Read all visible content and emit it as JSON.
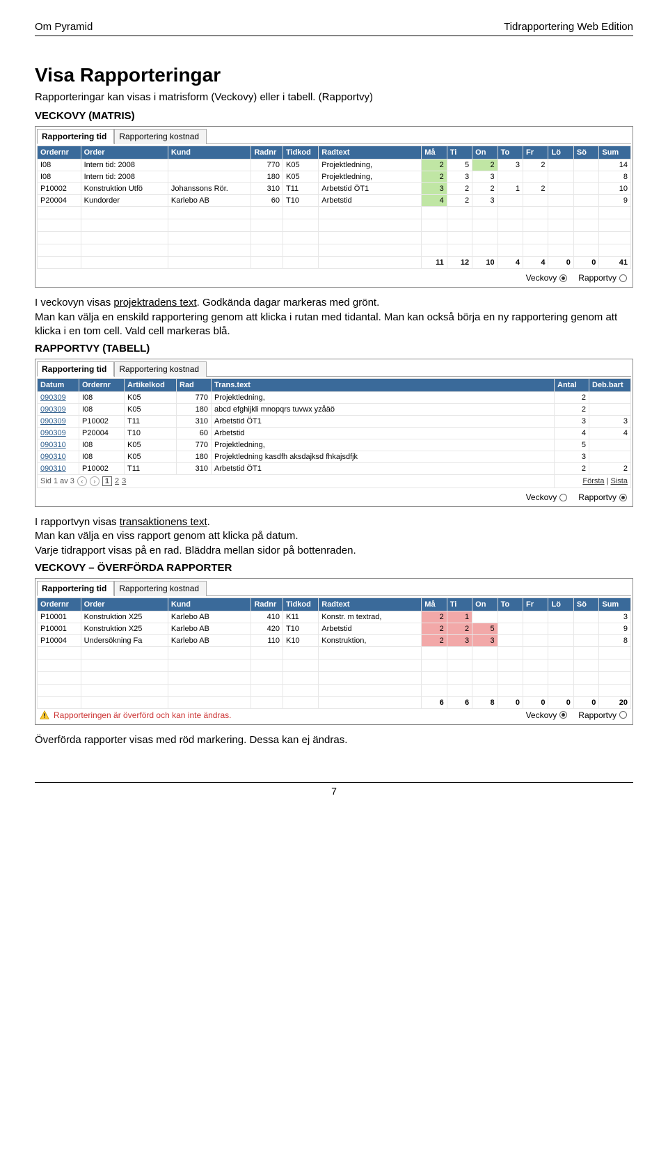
{
  "header": {
    "left": "Om Pyramid",
    "right": "Tidrapportering Web Edition"
  },
  "title": "Visa Rapporteringar",
  "intro": "Rapporteringar kan visas i matrisform (Veckovy) eller i tabell. (Rapportvy)",
  "sectionA": "VECKOVY (MATRIS)",
  "tabs": {
    "active": "Rapportering tid",
    "inactive": "Rapportering kostnad"
  },
  "matrix": {
    "headers": [
      "Ordernr",
      "Order",
      "Kund",
      "Radnr",
      "Tidkod",
      "Radtext",
      "Må",
      "Ti",
      "On",
      "To",
      "Fr",
      "Lö",
      "Sö",
      "Sum"
    ],
    "rows": [
      {
        "order": "I08",
        "orderTxt": "Intern tid: 2008",
        "kund": "",
        "radnr": "770",
        "tidkod": "K05",
        "radtext": "Projektledning,",
        "days": [
          "2",
          "5",
          "2",
          "3",
          "2",
          "",
          ""
        ],
        "sum": "14",
        "green": [
          0,
          2
        ]
      },
      {
        "order": "I08",
        "orderTxt": "Intern tid: 2008",
        "kund": "",
        "radnr": "180",
        "tidkod": "K05",
        "radtext": "Projektledning,",
        "days": [
          "2",
          "3",
          "3",
          "",
          "",
          "",
          ""
        ],
        "sum": "8",
        "green": [
          0
        ]
      },
      {
        "order": "P10002",
        "orderTxt": "Konstruktion Utfö",
        "kund": "Johanssons Rör.",
        "radnr": "310",
        "tidkod": "T11",
        "radtext": "Arbetstid ÖT1",
        "days": [
          "3",
          "2",
          "2",
          "1",
          "2",
          "",
          ""
        ],
        "sum": "10",
        "green": [
          0
        ]
      },
      {
        "order": "P20004",
        "orderTxt": "Kundorder",
        "kund": "Karlebo AB",
        "radnr": "60",
        "tidkod": "T10",
        "radtext": "Arbetstid",
        "days": [
          "4",
          "2",
          "3",
          "",
          "",
          "",
          ""
        ],
        "sum": "9",
        "green": [
          0
        ]
      }
    ],
    "totals": [
      "11",
      "12",
      "10",
      "4",
      "4",
      "0",
      "0",
      "41"
    ]
  },
  "viewToggle": {
    "veckovy": "Veckovy",
    "rapportvy": "Rapportvy"
  },
  "paraA": "I veckovyn visas projektradens text. Godkända dagar markeras med grönt.\nMan kan välja en enskild rapportering genom att klicka i rutan med tidantal. Man kan också börja en ny rapportering genom att klicka i en tom cell. Vald cell markeras blå.",
  "paraA_underline": "projektradens text",
  "sectionB": "RAPPORTVY (TABELL)",
  "tableB": {
    "headers": [
      "Datum",
      "Ordernr",
      "Artikelkod",
      "Rad",
      "Trans.text",
      "Antal",
      "Deb.bart"
    ],
    "rows": [
      {
        "datum": "090309",
        "ord": "I08",
        "art": "K05",
        "rad": "770",
        "txt": "Projektledning,",
        "ant": "2",
        "deb": ""
      },
      {
        "datum": "090309",
        "ord": "I08",
        "art": "K05",
        "rad": "180",
        "txt": "abcd efghijkli mnopqrs tuvwx yzåäö",
        "ant": "2",
        "deb": ""
      },
      {
        "datum": "090309",
        "ord": "P10002",
        "art": "T11",
        "rad": "310",
        "txt": "Arbetstid ÖT1",
        "ant": "3",
        "deb": "3"
      },
      {
        "datum": "090309",
        "ord": "P20004",
        "art": "T10",
        "rad": "60",
        "txt": "Arbetstid",
        "ant": "4",
        "deb": "4"
      },
      {
        "datum": "090310",
        "ord": "I08",
        "art": "K05",
        "rad": "770",
        "txt": "Projektledning,",
        "ant": "5",
        "deb": ""
      },
      {
        "datum": "090310",
        "ord": "I08",
        "art": "K05",
        "rad": "180",
        "txt": "Projektledning kasdfh aksdajksd fhkajsdfjk",
        "ant": "3",
        "deb": ""
      },
      {
        "datum": "090310",
        "ord": "P10002",
        "art": "T11",
        "rad": "310",
        "txt": "Arbetstid ÖT1",
        "ant": "2",
        "deb": "2"
      }
    ],
    "pager": {
      "left": "Sid 1 av 3",
      "pages": [
        "1",
        "2",
        "3"
      ],
      "first": "Första",
      "last": "Sista"
    }
  },
  "paraB": "I rapportvyn visas transaktionens text.\nMan kan välja en viss rapport genom att klicka på datum.\nVarje tidrapport visas på en rad. Bläddra mellan sidor på bottenraden.",
  "paraB_underline": "transaktionens text",
  "sectionC": "VECKOVY – ÖVERFÖRDA RAPPORTER",
  "tableC": {
    "rows": [
      {
        "order": "P10001",
        "orderTxt": "Konstruktion X25",
        "kund": "Karlebo AB",
        "radnr": "410",
        "tidkod": "K11",
        "radtext": "Konstr. m textrad,",
        "days": [
          "2",
          "1",
          "",
          "",
          "",
          "",
          ""
        ],
        "sum": "3",
        "red": [
          0,
          1
        ]
      },
      {
        "order": "P10001",
        "orderTxt": "Konstruktion X25",
        "kund": "Karlebo AB",
        "radnr": "420",
        "tidkod": "T10",
        "radtext": "Arbetstid",
        "days": [
          "2",
          "2",
          "5",
          "",
          "",
          "",
          ""
        ],
        "sum": "9",
        "red": [
          0,
          1,
          2
        ]
      },
      {
        "order": "P10004",
        "orderTxt": "Undersökning Fa",
        "kund": "Karlebo AB",
        "radnr": "110",
        "tidkod": "K10",
        "radtext": "Konstruktion,",
        "days": [
          "2",
          "3",
          "3",
          "",
          "",
          "",
          ""
        ],
        "sum": "8",
        "red": [
          0,
          1,
          2
        ]
      }
    ],
    "totals": [
      "6",
      "6",
      "8",
      "0",
      "0",
      "0",
      "0",
      "20"
    ],
    "warning": "Rapporteringen är överförd och kan inte ändras."
  },
  "paraC": "Överförda rapporter visas med röd markering. Dessa kan ej ändras.",
  "pageNum": "7"
}
